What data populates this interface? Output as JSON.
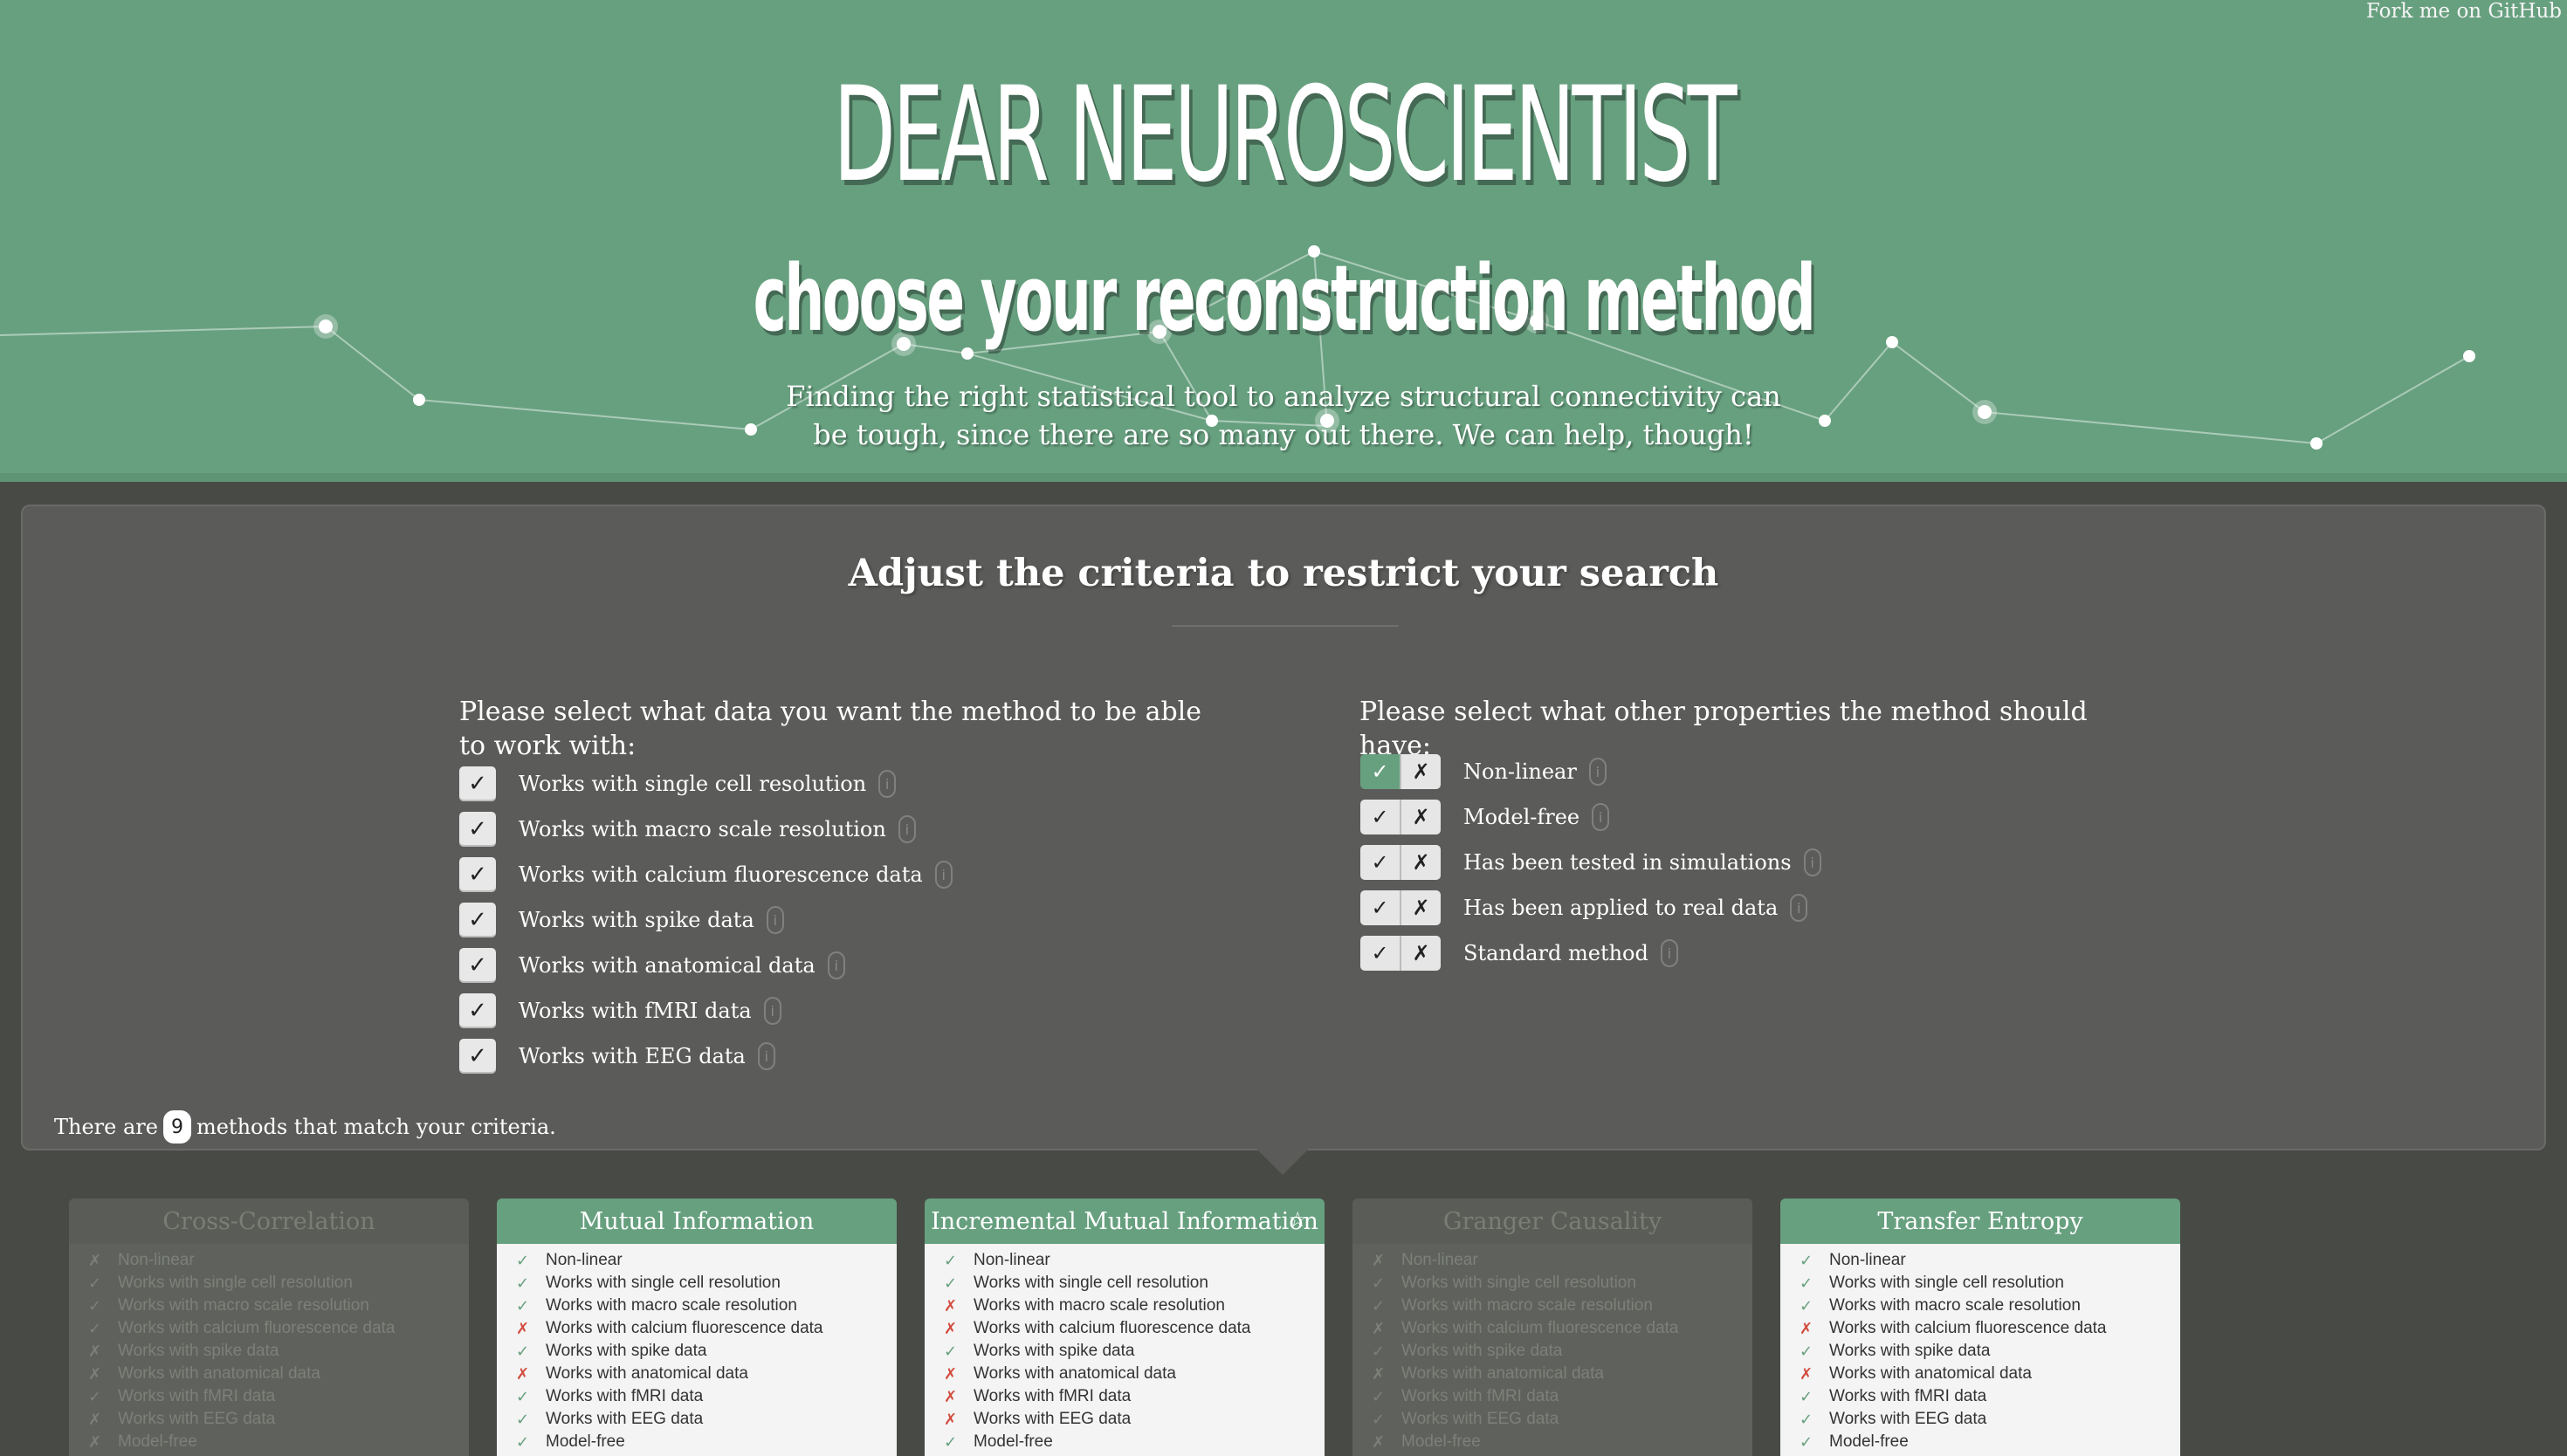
{
  "header": {
    "fork_link": "Fork me on GitHub",
    "title": "DEAR NEUROSCIENTIST",
    "subtitle": "choose your reconstruction method",
    "description": "Finding the right statistical tool to analyze structural connectivity can be tough, since there are so many out there. We can help, though!"
  },
  "criteria": {
    "title": "Adjust the criteria to restrict your search",
    "data_heading": "Please select what data you want the method to be able to work with:",
    "data_options": [
      {
        "label": "Works with single cell resolution",
        "checked": true
      },
      {
        "label": "Works with macro scale resolution",
        "checked": true
      },
      {
        "label": "Works with calcium fluorescence data",
        "checked": true
      },
      {
        "label": "Works with spike data",
        "checked": true
      },
      {
        "label": "Works with anatomical data",
        "checked": true
      },
      {
        "label": "Works with fMRI data",
        "checked": true
      },
      {
        "label": "Works with EEG data",
        "checked": true
      }
    ],
    "property_heading": "Please select what other properties the method should have:",
    "property_options": [
      {
        "label": "Non-linear",
        "state": "yes"
      },
      {
        "label": "Model-free",
        "state": "any"
      },
      {
        "label": "Has been tested in simulations",
        "state": "any"
      },
      {
        "label": "Has been applied to real data",
        "state": "any"
      },
      {
        "label": "Standard method",
        "state": "any"
      }
    ],
    "check_glyph": "✓",
    "cross_glyph": "✗",
    "info_glyph": "i",
    "count_prefix": "There are",
    "count_value": "9",
    "count_suffix": "methods that match your criteria."
  },
  "methods": [
    {
      "name": "Cross-Correlation",
      "active": false,
      "starred": false,
      "props": [
        {
          "label": "Non-linear",
          "ok": false
        },
        {
          "label": "Works with single cell resolution",
          "ok": true
        },
        {
          "label": "Works with macro scale resolution",
          "ok": true
        },
        {
          "label": "Works with calcium fluorescence data",
          "ok": true
        },
        {
          "label": "Works with spike data",
          "ok": false
        },
        {
          "label": "Works with anatomical data",
          "ok": false
        },
        {
          "label": "Works with fMRI data",
          "ok": true
        },
        {
          "label": "Works with EEG data",
          "ok": false
        },
        {
          "label": "Model-free",
          "ok": false
        }
      ]
    },
    {
      "name": "Mutual Information",
      "active": true,
      "starred": false,
      "props": [
        {
          "label": "Non-linear",
          "ok": true
        },
        {
          "label": "Works with single cell resolution",
          "ok": true
        },
        {
          "label": "Works with macro scale resolution",
          "ok": true
        },
        {
          "label": "Works with calcium fluorescence data",
          "ok": false
        },
        {
          "label": "Works with spike data",
          "ok": true
        },
        {
          "label": "Works with anatomical data",
          "ok": false
        },
        {
          "label": "Works with fMRI data",
          "ok": true
        },
        {
          "label": "Works with EEG data",
          "ok": true
        },
        {
          "label": "Model-free",
          "ok": true
        }
      ]
    },
    {
      "name": "Incremental Mutual Information",
      "active": true,
      "starred": true,
      "props": [
        {
          "label": "Non-linear",
          "ok": true
        },
        {
          "label": "Works with single cell resolution",
          "ok": true
        },
        {
          "label": "Works with macro scale resolution",
          "ok": false
        },
        {
          "label": "Works with calcium fluorescence data",
          "ok": false
        },
        {
          "label": "Works with spike data",
          "ok": true
        },
        {
          "label": "Works with anatomical data",
          "ok": false
        },
        {
          "label": "Works with fMRI data",
          "ok": false
        },
        {
          "label": "Works with EEG data",
          "ok": false
        },
        {
          "label": "Model-free",
          "ok": true
        }
      ]
    },
    {
      "name": "Granger Causality",
      "active": false,
      "starred": false,
      "props": [
        {
          "label": "Non-linear",
          "ok": false
        },
        {
          "label": "Works with single cell resolution",
          "ok": true
        },
        {
          "label": "Works with macro scale resolution",
          "ok": true
        },
        {
          "label": "Works with calcium fluorescence data",
          "ok": false
        },
        {
          "label": "Works with spike data",
          "ok": true
        },
        {
          "label": "Works with anatomical data",
          "ok": false
        },
        {
          "label": "Works with fMRI data",
          "ok": true
        },
        {
          "label": "Works with EEG data",
          "ok": true
        },
        {
          "label": "Model-free",
          "ok": false
        }
      ]
    },
    {
      "name": "Transfer Entropy",
      "active": true,
      "starred": false,
      "props": [
        {
          "label": "Non-linear",
          "ok": true
        },
        {
          "label": "Works with single cell resolution",
          "ok": true
        },
        {
          "label": "Works with macro scale resolution",
          "ok": true
        },
        {
          "label": "Works with calcium fluorescence data",
          "ok": false
        },
        {
          "label": "Works with spike data",
          "ok": true
        },
        {
          "label": "Works with anatomical data",
          "ok": false
        },
        {
          "label": "Works with fMRI data",
          "ok": true
        },
        {
          "label": "Works with EEG data",
          "ok": true
        },
        {
          "label": "Model-free",
          "ok": true
        }
      ]
    }
  ],
  "star_glyph": "☆",
  "colors": {
    "brand_green": "#67a07f",
    "background": "#484a45",
    "panel": "#5b5b59",
    "no_red": "#d24b3e"
  }
}
